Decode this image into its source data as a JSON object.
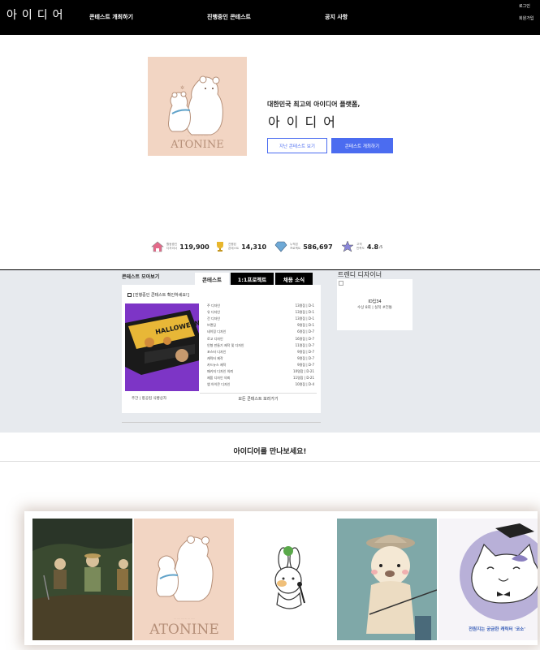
{
  "nav": {
    "logo": "아이디어",
    "links": [
      "콘테스트 개최하기",
      "진행중인 콘테스트",
      "공지 사항"
    ],
    "login": "로그인",
    "signup": "회원가입"
  },
  "hero": {
    "tagline": "대한민국 최고의 아이디어 플랫폼,",
    "brand": "아이디어",
    "btn_past": "지난 콘테스트 보기",
    "btn_host": "콘테스트 개최하기",
    "image_caption": "ATONINE"
  },
  "stats": [
    {
      "label1": "활동중인",
      "label2": "디자이너",
      "value": "119,900",
      "icon": "house-icon"
    },
    {
      "label1": "진행된",
      "label2": "콘테스트",
      "value": "14,310",
      "icon": "trophy-icon"
    },
    {
      "label1": "누적된",
      "label2": "프로젝트",
      "value": "586,697",
      "icon": "diamond-icon"
    },
    {
      "label1": "고객",
      "label2": "만족도",
      "value": "4.8",
      "suffix": "/5",
      "icon": "star-icon"
    }
  ],
  "contest": {
    "section_title": "콘테스트 모아보기",
    "tabs": [
      "콘테스트",
      "1:1프로젝트",
      "채용 소식"
    ],
    "notice": "[진행중인 콘테스트 확인하세요!]",
    "rows": [
      {
        "title": "주 디자인",
        "meta": "13명참 | D-1"
      },
      {
        "title": "유 디자인",
        "meta": "13명참 | D-1"
      },
      {
        "title": "건 디자인",
        "meta": "13명참 | D-1"
      },
      {
        "title": "브랜딩",
        "meta": "9명참 | D-1"
      },
      {
        "title": "네이밍 디자인",
        "meta": "6명참 | D-7"
      },
      {
        "title": "로고 디자인",
        "meta": "16명참 | D-7"
      },
      {
        "title": "인형 만들기 제작 및 디자인",
        "meta": "11명참 | D-7"
      },
      {
        "title": "포스터 디자인",
        "meta": "9명참 | D-7"
      },
      {
        "title": "캐릭터 제작",
        "meta": "9명참 | D-7"
      },
      {
        "title": "카드뉴스 제작",
        "meta": "9명참 | D-7"
      },
      {
        "title": "패키지 디자인 의뢰",
        "meta": "10명참 | D-21"
      },
      {
        "title": "제품 디자인 의뢰",
        "meta": "11명참 | D-21"
      },
      {
        "title": "앱 아이콘 디자인",
        "meta": "10명참 | D-4"
      }
    ],
    "featured_caption": "주간 | 항공컵 식빵상자",
    "view_all": "모든 콘테스트 보러가기"
  },
  "trend": {
    "title": "트렌디 디자이너",
    "designer": "ID입34",
    "meta": "수상 8회 | 실적 #전통"
  },
  "meet": {
    "title": "아이디어를 만나보세요!"
  },
  "gallery": [
    {
      "name": "farmers-card"
    },
    {
      "name": "bears-card",
      "caption": "ATONINE"
    },
    {
      "name": "rabbit-card"
    },
    {
      "name": "bear-fishing-card"
    },
    {
      "name": "cat-card",
      "caption": "전원지는 궁금한 캐릭터 '코소'"
    }
  ]
}
